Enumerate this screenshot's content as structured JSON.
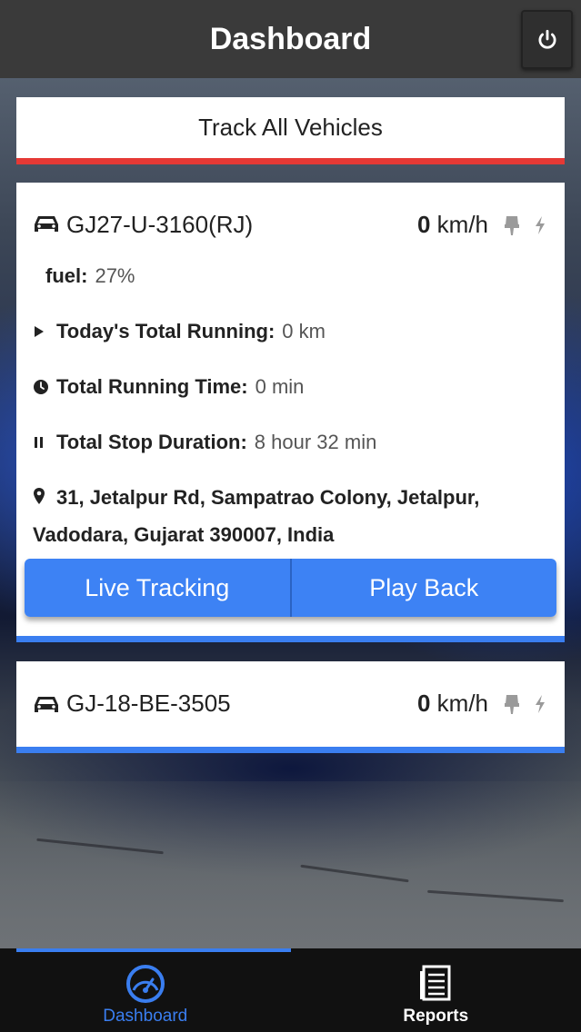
{
  "header": {
    "title": "Dashboard",
    "power_icon": "power-icon"
  },
  "track_all": {
    "label": "Track All Vehicles"
  },
  "colors": {
    "accent_blue": "#3a7ef0",
    "accent_red": "#e53935",
    "header_bg": "#3a3a3a"
  },
  "vehicles": [
    {
      "name": "GJ27-U-3160(RJ)",
      "speed_value": "0",
      "speed_unit": "km/h",
      "fuel_label": "fuel:",
      "fuel_value": "27%",
      "running_label": "Today's Total Running:",
      "running_value": "0 km",
      "running_time_label": "Total Running Time:",
      "running_time_value": "0 min",
      "stop_label": "Total Stop Duration:",
      "stop_value": "8 hour 32 min",
      "address": "31, Jetalpur Rd, Sampatrao Colony, Jetalpur, Vadodara, Gujarat 390007, India",
      "live_tracking_label": "Live Tracking",
      "playback_label": "Play Back"
    },
    {
      "name": "GJ-18-BE-3505",
      "speed_value": "0",
      "speed_unit": "km/h"
    }
  ],
  "bottom_nav": [
    {
      "label": "Dashboard",
      "icon": "speedometer-icon",
      "active": true
    },
    {
      "label": "Reports",
      "icon": "reports-icon",
      "active": false
    }
  ]
}
